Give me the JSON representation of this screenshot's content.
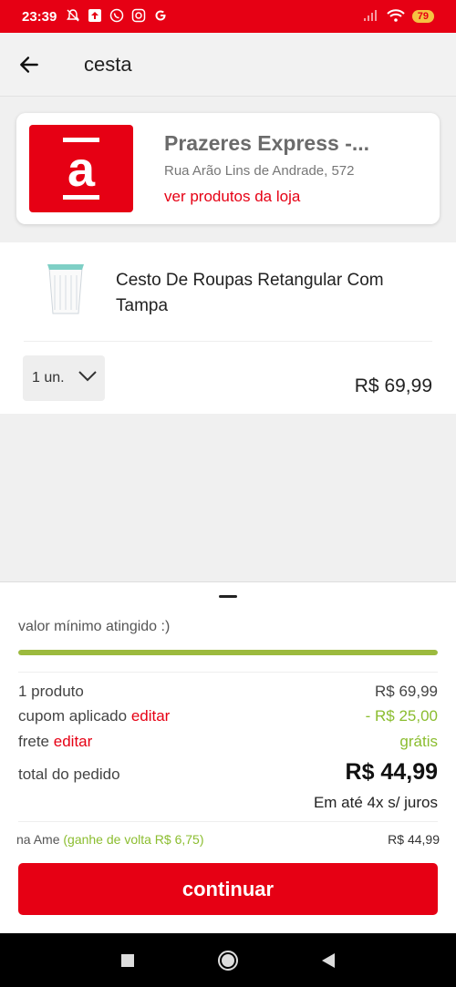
{
  "status_bar": {
    "time": "23:39",
    "battery": "79",
    "left_icons": [
      "mute-icon",
      "upload-icon",
      "whatsapp-icon",
      "instagram-icon",
      "google-icon"
    ],
    "right_icons": [
      "signal-icon",
      "wifi-icon",
      "battery-icon"
    ],
    "color": "#e60014"
  },
  "header": {
    "title": "cesta",
    "back_icon": "back-arrow-icon"
  },
  "store": {
    "logo_letter": "a",
    "name": "Prazeres Express -...",
    "address": "Rua Arão Lins de Andrade, 572",
    "link": "ver produtos da loja",
    "brand_color": "#e60014"
  },
  "product": {
    "name": "Cesto De Roupas Retangular Com Tampa",
    "quantity": "1 un.",
    "price": "R$ 69,99"
  },
  "summary": {
    "min_value_text": "valor mínimo atingido :)",
    "progress_fraction": 1,
    "progress_color": "#9cba3e",
    "items_label": "1 produto",
    "items_value": "R$ 69,99",
    "coupon_label": "cupom aplicado",
    "coupon_edit": "editar",
    "coupon_value": "- R$ 25,00",
    "shipping_label": "frete",
    "shipping_edit": "editar",
    "shipping_value": "grátis",
    "total_label": "total do pedido",
    "total_value": "R$ 44,99",
    "installments": "Em até 4x s/ juros",
    "ame_label": "na Ame",
    "ame_cashback": "(ganhe de volta R$ 6,75)",
    "ame_price": "R$ 44,99",
    "continue_label": "continuar"
  },
  "nav_bar": {
    "icons": [
      "recent-apps-icon",
      "home-icon",
      "back-icon"
    ]
  }
}
